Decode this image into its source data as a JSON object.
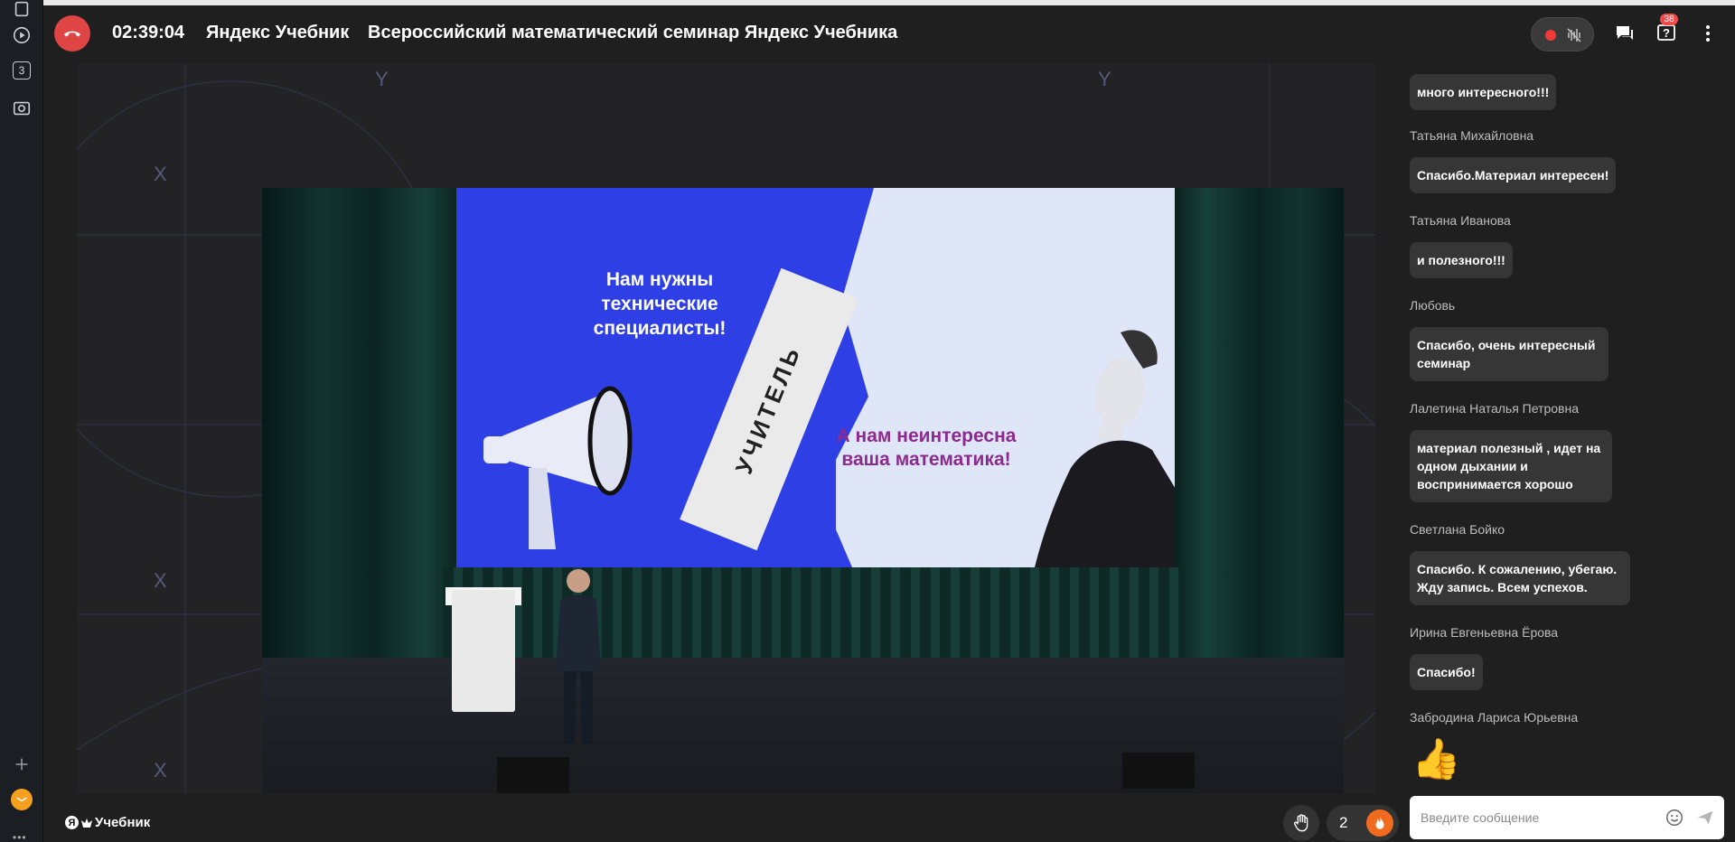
{
  "header": {
    "timer": "02:39:04",
    "brand": "Яндекс Учебник",
    "title": "Всероссийский математический семинар Яндекс Учебника",
    "questions_badge": "38"
  },
  "rail": {
    "tab_count": "3"
  },
  "slide": {
    "left_text": "Нам нужны технические специалисты!",
    "paper_text": "УЧИТЕЛЬ",
    "right_text": "А нам неинтересна ваша математика!"
  },
  "chat": {
    "messages": [
      {
        "name": "",
        "text": "много интересного!!!"
      },
      {
        "name": "Татьяна Михайловна",
        "text": "Спасибо.Материал интересен!"
      },
      {
        "name": "Татьяна Иванова",
        "text": "и полезного!!!"
      },
      {
        "name": "Любовь",
        "text": "Спасибо, очень интересный семинар"
      },
      {
        "name": "Лалетина Наталья Петровна",
        "text": "материал полезный , идет на одном дыхании и воспринимается хорошо"
      },
      {
        "name": "Светлана Бойко",
        "text": "Спасибо. К сожалению, убегаю. Жду запись. Всем успехов."
      },
      {
        "name": "Ирина Евгеньевна Ёрова",
        "text": "Спасибо!"
      },
      {
        "name": "Забродина Лариса Юрьевна",
        "text": "👍"
      }
    ],
    "input_placeholder": "Введите сообщение"
  },
  "bottom": {
    "logo_text": "Учебник",
    "reaction_count": "2"
  },
  "colors": {
    "hangup": "#e04545",
    "record": "#f03a3a",
    "fire": "#f06b1e",
    "slide_blue": "#2f3fe6",
    "slide_purple": "#8b2b8f"
  }
}
